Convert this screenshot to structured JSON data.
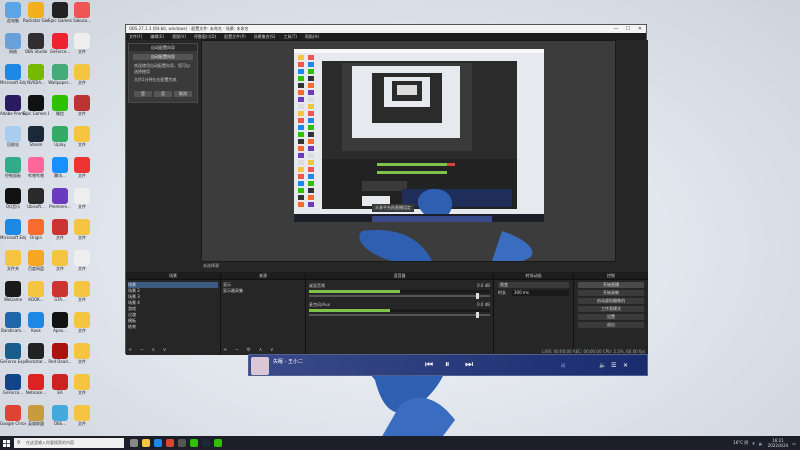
{
  "desktop": {
    "icons": [
      {
        "label": "此电脑",
        "color": "#5ba4e6"
      },
      {
        "label": "Rockstar Games...",
        "color": "#f2b01e"
      },
      {
        "label": "Epic Games",
        "color": "#222222"
      },
      {
        "label": "Sakura...",
        "color": "#e55"
      },
      {
        "label": "网络",
        "color": "#6aa0d8"
      },
      {
        "label": "OBS Studio",
        "color": "#302e31"
      },
      {
        "label": "GeForce...",
        "color": "#e23"
      },
      {
        "label": "文件",
        "color": "#eeeeee"
      },
      {
        "label": "Microsoft Edge",
        "color": "#1e88e5"
      },
      {
        "label": "NVIDIA...",
        "color": "#76b900"
      },
      {
        "label": "Wallpaper...",
        "color": "#4a7"
      },
      {
        "label": "文件",
        "color": "#f5c542"
      },
      {
        "label": "Adobe Premiere...",
        "color": "#2a1a5e"
      },
      {
        "label": "Epic Games Launcher",
        "color": "#111111"
      },
      {
        "label": "微信",
        "color": "#2dc100"
      },
      {
        "label": "文件",
        "color": "#b33"
      },
      {
        "label": "回收站",
        "color": "#aaccee"
      },
      {
        "label": "Steam",
        "color": "#1b2838"
      },
      {
        "label": "Uplay",
        "color": "#3a6"
      },
      {
        "label": "文件",
        "color": "#f5c542"
      },
      {
        "label": "控制面板",
        "color": "#3a8"
      },
      {
        "label": "哔哩哔哩",
        "color": "#ff6699"
      },
      {
        "label": "腾讯...",
        "color": "#1890ff"
      },
      {
        "label": "文件",
        "color": "#e33"
      },
      {
        "label": "QQ音乐",
        "color": "#111111"
      },
      {
        "label": "Ubisoft...",
        "color": "#2a2a2a"
      },
      {
        "label": "Premiere...",
        "color": "#6a3abf"
      },
      {
        "label": "文件",
        "color": "#eeeeee"
      },
      {
        "label": "Microsoft Edge",
        "color": "#1e88e5"
      },
      {
        "label": "Origin",
        "color": "#f56c2d"
      },
      {
        "label": "文件",
        "color": "#c33"
      },
      {
        "label": "文件",
        "color": "#f5c542"
      },
      {
        "label": "文件夹",
        "color": "#f5c542"
      },
      {
        "label": "百度网盘",
        "color": "#f5a623"
      },
      {
        "label": "文件",
        "color": "#f5c542"
      },
      {
        "label": "文件",
        "color": "#eeeeee"
      },
      {
        "label": "WeGame",
        "color": "#1a1a1a"
      },
      {
        "label": "KOOK...",
        "color": "#f5c542"
      },
      {
        "label": "GTA...",
        "color": "#cc3333"
      },
      {
        "label": "文件",
        "color": "#f5c542"
      },
      {
        "label": "Bandicam...",
        "color": "#2266aa"
      },
      {
        "label": "Kook",
        "color": "#1e88e5"
      },
      {
        "label": "Apex...",
        "color": "#111111"
      },
      {
        "label": "文件",
        "color": "#f5c542"
      },
      {
        "label": "GeForce Experience",
        "color": "#1a5c8a"
      },
      {
        "label": "Rockstar...",
        "color": "#222222"
      },
      {
        "label": "Red Dead...",
        "color": "#aa1111"
      },
      {
        "label": "文件",
        "color": "#f5c542"
      },
      {
        "label": "GeForce...",
        "color": "#114488"
      },
      {
        "label": "Netease...",
        "color": "#d22"
      },
      {
        "label": "EA",
        "color": "#cc2222"
      },
      {
        "label": "文件",
        "color": "#f5c542"
      },
      {
        "label": "Google Chrome",
        "color": "#dd4433"
      },
      {
        "label": "英雄联盟",
        "color": "#c89b3c"
      },
      {
        "label": "OBS...",
        "color": "#44aadd"
      },
      {
        "label": "文件",
        "color": "#f5c542"
      }
    ]
  },
  "obs": {
    "title": "OBS 27.1.3 (64-bit, windows) - 配置文件: 未命名 - 场景: 未命名",
    "window_buttons": {
      "minimize": "—",
      "maximize": "☐",
      "close": "✕"
    },
    "menu": [
      "文件(F)",
      "编辑(E)",
      "视图(V)",
      "停靠窗口(D)",
      "配置文件(P)",
      "场景集合(S)",
      "工具(T)",
      "帮助(H)"
    ],
    "notice": {
      "title": "自动配置向导",
      "box": "自动配置向导",
      "text_line1": "欢迎使用自动配置向导，您可以选择使用",
      "text_line2": "大约1分钟左右配置完成",
      "btn_yes": "是",
      "btn_no": "否",
      "btn_cancel": "取消"
    },
    "preview_status": "未选择源",
    "nested_caption": "众多平台的直播设定",
    "docks": {
      "scenes": {
        "title": "场景",
        "items": [
          "场景",
          "场景 2",
          "场景 3",
          "场景 4",
          "游戏",
          "过渡",
          "模板",
          "结束"
        ]
      },
      "sources": {
        "title": "来源",
        "items": [
          "显示",
          "显示器采集"
        ]
      },
      "mixer": {
        "title": "混音器",
        "tracks": [
          {
            "name": "桌面音频",
            "db": "0.0 dB",
            "level_pct": 50
          },
          {
            "name": "麦克风/Aux",
            "db": "0.0 dB",
            "level_pct": 45
          }
        ]
      },
      "transitions": {
        "title": "转场动画",
        "type": "渐变",
        "duration_label": "时长",
        "duration": "300 ms"
      },
      "controls": {
        "title": "控制",
        "buttons": [
          "开始直播",
          "开始录制",
          "启动虚拟摄像机",
          "工作室模式",
          "设置",
          "退出"
        ]
      }
    },
    "status": "LIVE: 00:00:00   REC: 00:00:00   CPU: 2.5%, 60.00 fps"
  },
  "music_player": {
    "song": "失眠 - 王小二",
    "prev": "⏮",
    "pause": "⏸",
    "next": "⏭",
    "tag": "词"
  },
  "taskbar": {
    "search_placeholder": "在这里输入你要搜索的内容",
    "apps": [
      {
        "name": "task-view",
        "color": "#888888"
      },
      {
        "name": "file-explorer",
        "color": "#f5c542"
      },
      {
        "name": "edge",
        "color": "#1e88e5"
      },
      {
        "name": "chrome",
        "color": "#dd4433"
      },
      {
        "name": "obs",
        "color": "#555555"
      },
      {
        "name": "qq-music",
        "color": "#2dc100"
      },
      {
        "name": "steam",
        "color": "#1b2838"
      },
      {
        "name": "wechat",
        "color": "#2dc100"
      }
    ],
    "weather": "16°C 阴",
    "time": "16:21",
    "date": "2022/4/24"
  },
  "colors": {
    "meter_green": "#7ec24a",
    "meter_red": "#d94040",
    "obs_bg": "#2b2b2b"
  }
}
